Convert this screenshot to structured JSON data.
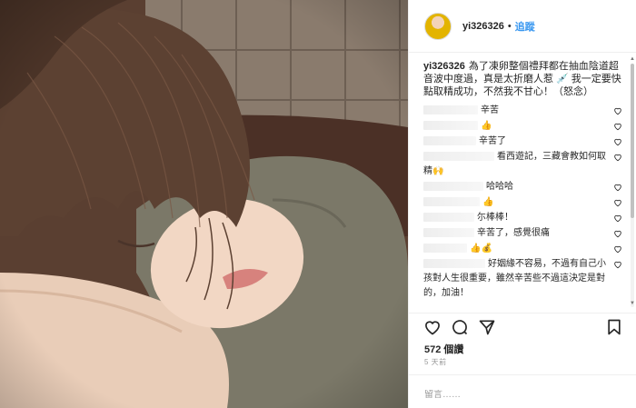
{
  "header": {
    "username": "yi326326",
    "separator": "•",
    "follow_label": "追蹤"
  },
  "caption": {
    "username": "yi326326",
    "text": "為了凍卵整個禮拜都在抽血陰道超音波中度過，真是太折磨人惹 💉 我一定要快點取精成功，不然我不甘心！（怒念）"
  },
  "comments": [
    {
      "text": "辛苦",
      "emoji": ""
    },
    {
      "text": "",
      "emoji": "👍"
    },
    {
      "text": "辛苦了",
      "emoji": ""
    },
    {
      "text": "看西遊記，三藏會教如何取精",
      "emoji": "🙌"
    },
    {
      "text": "哈哈哈",
      "emoji": ""
    },
    {
      "text": "",
      "emoji": "👍"
    },
    {
      "text": "尓棒棒！",
      "emoji": ""
    },
    {
      "text": "辛苦了，感覺很痛",
      "emoji": ""
    },
    {
      "text": "",
      "emoji": "👍💰"
    },
    {
      "text": "好姻緣不容易，不過有自己小孩對人生很重要，雖然辛苦些不過這決定是對的，加油！",
      "emoji": ""
    }
  ],
  "likes": {
    "text": "572 個讚"
  },
  "time": {
    "text": "5 天前"
  },
  "add_comment": {
    "placeholder": "留言……"
  },
  "icons": {
    "heart": "heart-icon",
    "comment": "comment-icon",
    "share": "share-icon",
    "bookmark": "bookmark-icon"
  },
  "colors": {
    "link": "#3897f0",
    "border": "#efefef",
    "muted": "#999999",
    "text": "#262626"
  }
}
